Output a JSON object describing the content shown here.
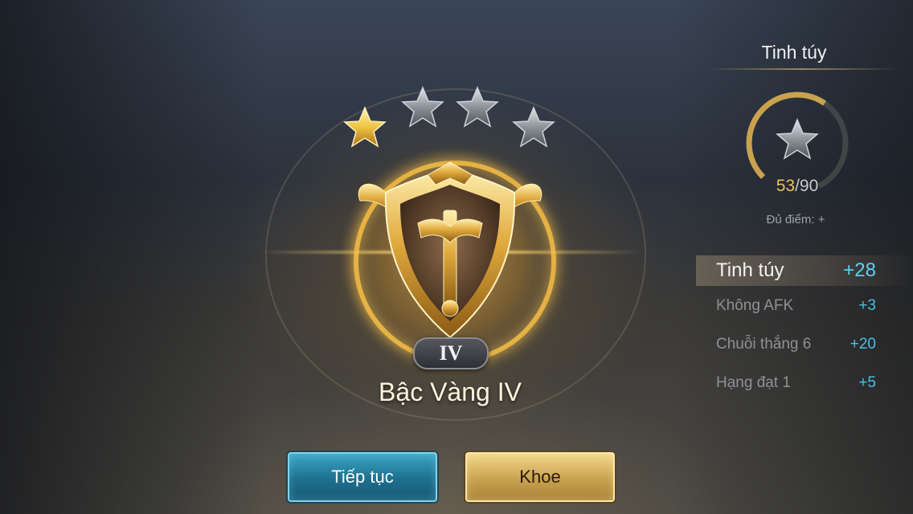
{
  "rank": {
    "tier_numeral": "IV",
    "title": "Bậc Vàng IV",
    "stars_total": 4,
    "stars_filled": 1
  },
  "buttons": {
    "continue_label": "Tiếp tục",
    "show_label": "Khoe"
  },
  "essence_panel": {
    "title": "Tinh túy",
    "progress_current": "53",
    "progress_separator": "/",
    "progress_max": "90",
    "points_note": "Đủ điểm: +",
    "breakdown": [
      {
        "label": "Tinh túy",
        "value": "+28"
      },
      {
        "label": "Không AFK",
        "value": "+3"
      },
      {
        "label": "Chuỗi thắng 6",
        "value": "+20"
      },
      {
        "label": "Hạng đạt 1",
        "value": "+5"
      }
    ]
  },
  "colors": {
    "gold": "#e8c25e",
    "bonus_value": "#47c0e6",
    "continue_button": "#1e6f8e",
    "show_button": "#c9a24f"
  },
  "icons": {
    "star_filled": "gold-star-icon",
    "star_empty": "silver-star-icon",
    "emblem": "gold-shield-emblem-icon"
  }
}
